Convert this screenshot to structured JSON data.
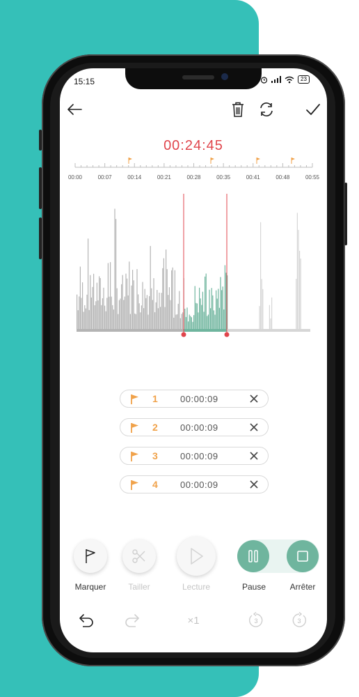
{
  "status_bar": {
    "time": "15:15",
    "battery": "23"
  },
  "header": {
    "back_icon": "arrow-left-icon",
    "delete_icon": "trash-icon",
    "refresh_icon": "refresh-icon",
    "confirm_icon": "check-icon"
  },
  "timer": {
    "value": "00:24:45"
  },
  "timeline": {
    "ticks": [
      "00:00",
      "00:07",
      "00:14",
      "00:21",
      "00:28",
      "00:35",
      "00:41",
      "00:48",
      "00:55"
    ]
  },
  "colors": {
    "background_accent": "#35c0b8",
    "timer_red": "#e0454c",
    "selection_green": "#6fb59e",
    "waveform_gray": "#b4b4b4",
    "waveform_light": "#d6d6d6",
    "flag_orange": "#f0a24a"
  },
  "markers": [
    {
      "number": "1",
      "time": "00:00:09"
    },
    {
      "number": "2",
      "time": "00:00:09"
    },
    {
      "number": "3",
      "time": "00:00:09"
    },
    {
      "number": "4",
      "time": "00:00:09"
    }
  ],
  "controls": {
    "mark_label": "Marquer",
    "trim_label": "Tailler",
    "play_label": "Lecture",
    "pause_label": "Pause",
    "stop_label": "Arrêter"
  },
  "bottom_bar": {
    "speed_label": "×1",
    "skip_back_value": "3",
    "skip_forward_value": "3"
  }
}
